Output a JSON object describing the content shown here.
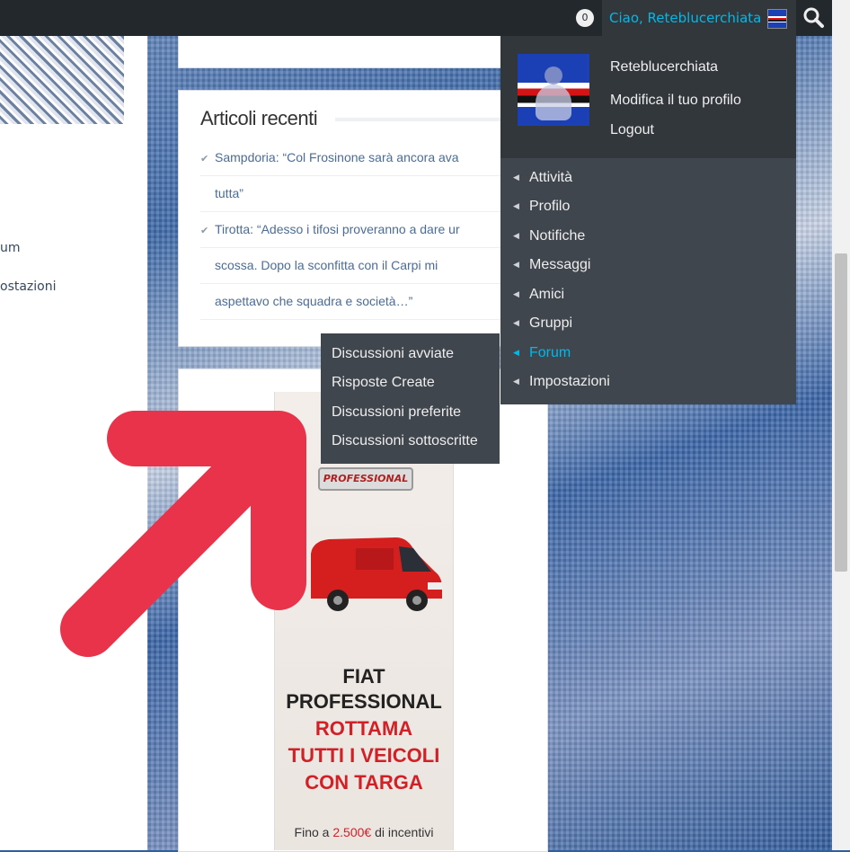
{
  "adminbar": {
    "notification_count": "0",
    "greeting": "Ciao, Reteblucerchiata"
  },
  "left_sidebar": {
    "link_1": "um",
    "link_2": "ostazioni"
  },
  "widget": {
    "title": "Articoli recenti",
    "posts": [
      {
        "line1": "Sampdoria: “Col Frosinone sarà ancora ava",
        "line2": "tutta”"
      },
      {
        "line1": "Tirotta: “Adesso i tifosi proveranno a dare ur",
        "line2": "scossa. Dopo la sconfitta con il Carpi mi",
        "line3": "aspettavo che squadra e società…”"
      }
    ]
  },
  "profile_menu": {
    "username": "Reteblucerchiata",
    "edit_profile": "Modifica il tuo profilo",
    "logout": "Logout",
    "items": [
      {
        "label": "Attività"
      },
      {
        "label": "Profilo"
      },
      {
        "label": "Notifiche"
      },
      {
        "label": "Messaggi"
      },
      {
        "label": "Amici"
      },
      {
        "label": "Gruppi"
      },
      {
        "label": "Forum"
      },
      {
        "label": "Impostazioni"
      }
    ],
    "active_item": "Forum"
  },
  "forum_submenu": {
    "items": [
      {
        "label": "Discussioni avviate"
      },
      {
        "label": "Risposte Create"
      },
      {
        "label": "Discussioni preferite"
      },
      {
        "label": "Discussioni sottoscritte"
      }
    ]
  },
  "ad": {
    "badge": "PROFESSIONAL",
    "line1": "FIAT",
    "line2": "PROFESSIONAL",
    "line3": "ROTTAMA",
    "line4": "TUTTI I VEICOLI",
    "line5": "CON TARGA",
    "footer_prefix": "Fino a",
    "footer_amount": "2.500€",
    "footer_suffix": "di incentivi"
  },
  "colors": {
    "adminbar_bg": "#23282d",
    "menu_bg": "#32373c",
    "submenu_bg": "#40464d",
    "accent": "#00b9eb",
    "arrow": "#e8334a"
  }
}
